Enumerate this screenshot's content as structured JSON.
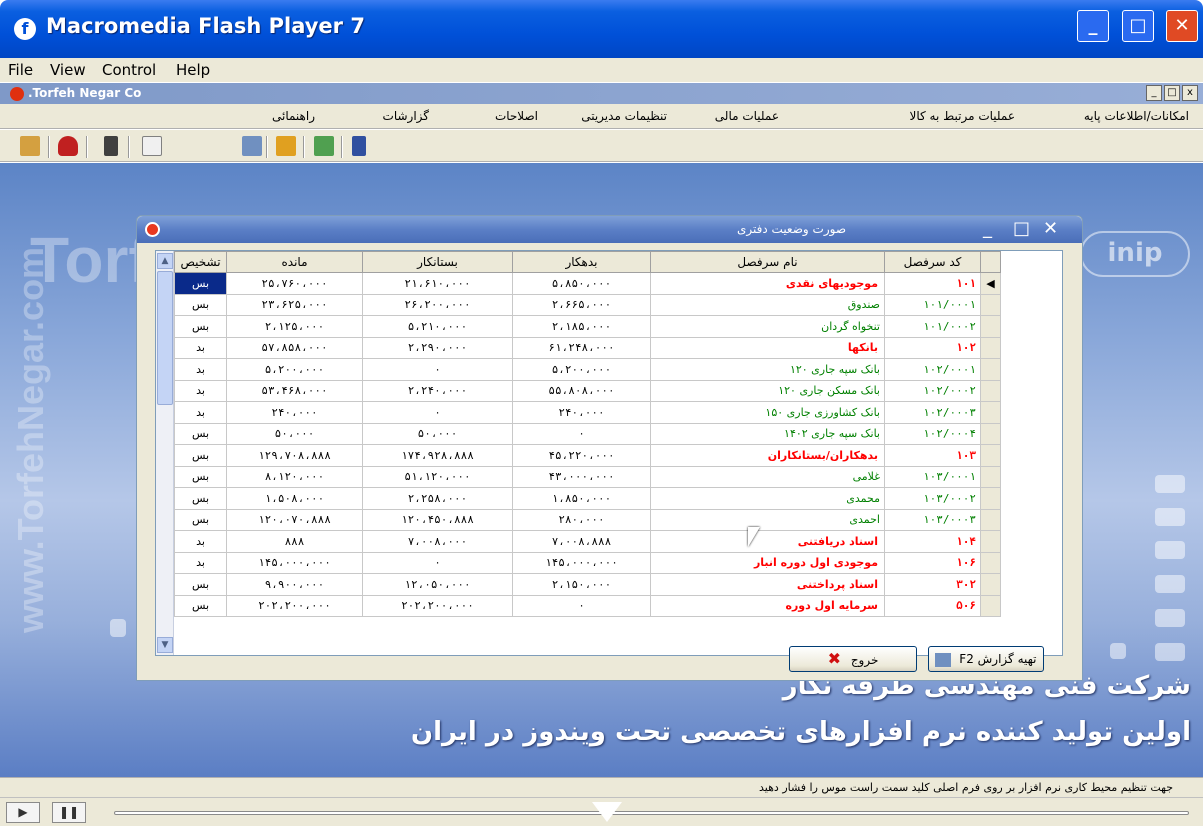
{
  "window": {
    "title": "Macromedia Flash Player 7",
    "min": "_",
    "max": "□",
    "close": "✕"
  },
  "menubar": [
    "File",
    "View",
    "Control",
    "Help"
  ],
  "inner": {
    "title": ".Torfeh Negar Co",
    "min": "_",
    "max": "□",
    "close": "x"
  },
  "appmenu": [
    "امکانات/اطلاعات پایه",
    "عملیات مرتبط به کالا",
    "عملیات مالی",
    "تنظیمات مدیریتی",
    "اصلاحات",
    "گزارشات",
    "راهنمائی"
  ],
  "toolbar_icons": [
    "printer-icon",
    "phone-icon",
    "calculator-icon",
    "notepad-icon",
    "report-icon",
    "pen-icon",
    "folder-icon",
    "exit-icon"
  ],
  "watermarks": {
    "left": "Torf",
    "vertical": "www.TorfehNegar.com",
    "right": "inip"
  },
  "company": {
    "line1": "شرکت فنی مهندسی طرفه نگار",
    "line2": "اولین تولید کننده نرم افزارهای تخصصی تحت ویندوز در ایران"
  },
  "dialog": {
    "title": "صورت وضعیت دفتری",
    "columns": [
      "کد سرفصل",
      "نام سرفصل",
      "بدهکار",
      "بستانکار",
      "مانده",
      "تشخیص"
    ],
    "rows": [
      {
        "code": "۱۰۱",
        "name": "موجودیهای نقدی",
        "debit": "۵،۸۵۰،۰۰۰",
        "credit": "۲۱،۶۱۰،۰۰۰",
        "balance": "۲۵،۷۶۰،۰۰۰",
        "diag": "بس",
        "bold": true,
        "selected": true
      },
      {
        "code": "۱۰۱/۰۰۰۱",
        "name": "صندوق",
        "debit": "۲،۶۶۵،۰۰۰",
        "credit": "۲۶،۲۰۰،۰۰۰",
        "balance": "۲۳،۶۲۵،۰۰۰",
        "diag": "بس",
        "bold": false
      },
      {
        "code": "۱۰۱/۰۰۰۲",
        "name": "تنخواه گردان",
        "debit": "۲،۱۸۵،۰۰۰",
        "credit": "۵،۲۱۰،۰۰۰",
        "balance": "۲،۱۲۵،۰۰۰",
        "diag": "بس",
        "bold": false
      },
      {
        "code": "۱۰۲",
        "name": "بانکها",
        "debit": "۶۱،۲۴۸،۰۰۰",
        "credit": "۲،۲۹۰،۰۰۰",
        "balance": "۵۷،۸۵۸،۰۰۰",
        "diag": "بد",
        "bold": true
      },
      {
        "code": "۱۰۲/۰۰۰۱",
        "name": "بانک سپه جاری ۱۲۰",
        "debit": "۵،۲۰۰،۰۰۰",
        "credit": "۰",
        "balance": "۵،۲۰۰،۰۰۰",
        "diag": "بد",
        "bold": false
      },
      {
        "code": "۱۰۲/۰۰۰۲",
        "name": "بانک مسکن جاری ۱۲۰",
        "debit": "۵۵،۸۰۸،۰۰۰",
        "credit": "۲،۲۴۰،۰۰۰",
        "balance": "۵۳،۴۶۸،۰۰۰",
        "diag": "بد",
        "bold": false
      },
      {
        "code": "۱۰۲/۰۰۰۳",
        "name": "بانک کشاورزی جاری ۱۵۰",
        "debit": "۲۴۰،۰۰۰",
        "credit": "۰",
        "balance": "۲۴۰،۰۰۰",
        "diag": "بد",
        "bold": false
      },
      {
        "code": "۱۰۲/۰۰۰۴",
        "name": "بانک سپه جاری ۱۴۰۲",
        "debit": "۰",
        "credit": "۵۰،۰۰۰",
        "balance": "۵۰،۰۰۰",
        "diag": "بس",
        "bold": false
      },
      {
        "code": "۱۰۳",
        "name": "بدهکاران/بستانکاران",
        "debit": "۴۵،۲۲۰،۰۰۰",
        "credit": "۱۷۴،۹۲۸،۸۸۸",
        "balance": "۱۲۹،۷۰۸،۸۸۸",
        "diag": "بس",
        "bold": true
      },
      {
        "code": "۱۰۳/۰۰۰۱",
        "name": "غلامی",
        "debit": "۴۳،۰۰۰،۰۰۰",
        "credit": "۵۱،۱۲۰،۰۰۰",
        "balance": "۸،۱۲۰،۰۰۰",
        "diag": "بس",
        "bold": false
      },
      {
        "code": "۱۰۳/۰۰۰۲",
        "name": "محمدی",
        "debit": "۱،۸۵۰،۰۰۰",
        "credit": "۲،۲۵۸،۰۰۰",
        "balance": "۱،۵۰۸،۰۰۰",
        "diag": "بس",
        "bold": false
      },
      {
        "code": "۱۰۳/۰۰۰۳",
        "name": "احمدی",
        "debit": "۲۸۰،۰۰۰",
        "credit": "۱۲۰،۴۵۰،۸۸۸",
        "balance": "۱۲۰،۰۷۰،۸۸۸",
        "diag": "بس",
        "bold": false
      },
      {
        "code": "۱۰۴",
        "name": "اسناد دریافتنی",
        "debit": "۷،۰۰۸،۸۸۸",
        "credit": "۷،۰۰۸،۰۰۰",
        "balance": "۸۸۸",
        "diag": "بد",
        "bold": true
      },
      {
        "code": "۱۰۶",
        "name": "موجودی اول دوره انبار",
        "debit": "۱۴۵،۰۰۰،۰۰۰",
        "credit": "۰",
        "balance": "۱۴۵،۰۰۰،۰۰۰",
        "diag": "بد",
        "bold": true
      },
      {
        "code": "۳۰۲",
        "name": "اسناد پرداختنی",
        "debit": "۲،۱۵۰،۰۰۰",
        "credit": "۱۲،۰۵۰،۰۰۰",
        "balance": "۹،۹۰۰،۰۰۰",
        "diag": "بس",
        "bold": true
      },
      {
        "code": "۵۰۶",
        "name": "سرمایه اول دوره",
        "debit": "۰",
        "credit": "۲۰۲،۲۰۰،۰۰۰",
        "balance": "۲۰۲،۲۰۰،۰۰۰",
        "diag": "بس",
        "bold": true
      }
    ],
    "buttons": {
      "report": "تهیه گزارش F2",
      "exit": "خروج"
    }
  },
  "status": "جهت تنظیم محیط کاری نرم افزار بر روی فرم اصلی کلید سمت راست موس را فشار دهید",
  "colors": {
    "title_blue": "#0050d8",
    "bold_row": "#ff0000",
    "normal_row": "#008000",
    "selection": "#0a2a8a"
  }
}
